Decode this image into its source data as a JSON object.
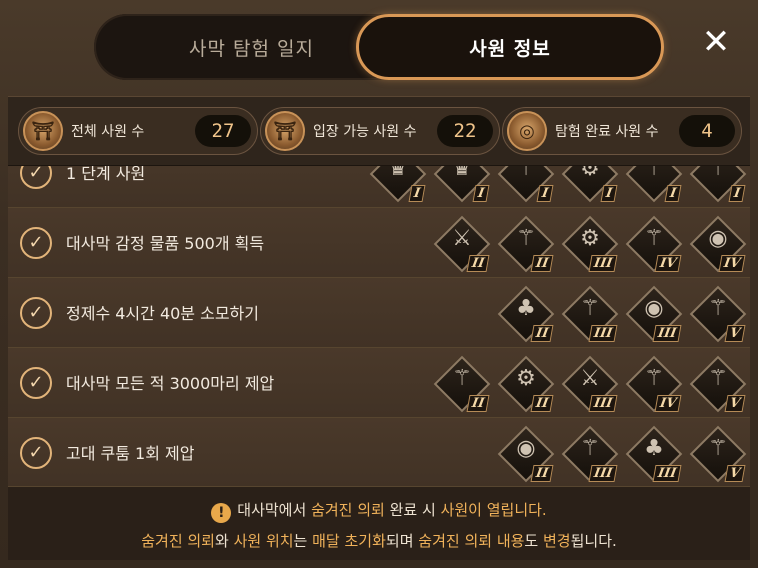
{
  "tabs": {
    "inactive_label": "사막 탐험 일지",
    "active_label": "사원 정보"
  },
  "close_icon": "close-icon",
  "stats": [
    {
      "label": "전체 사원 수",
      "value": "27",
      "icon": "temple-emblem-icon"
    },
    {
      "label": "입장 가능 사원 수",
      "value": "22",
      "icon": "temple-emblem-icon"
    },
    {
      "label": "탐험 완료 사원 수",
      "value": "4",
      "icon": "compass-emblem-icon"
    }
  ],
  "rows": [
    {
      "text": "1 단계 사원",
      "ranks": [
        "I",
        "I",
        "I",
        "I",
        "I",
        "I"
      ],
      "partial": true
    },
    {
      "text": "대사막 감정 물품 500개 획득",
      "ranks": [
        "II",
        "II",
        "III",
        "IV",
        "IV"
      ]
    },
    {
      "text": "정제수 4시간 40분 소모하기",
      "ranks": [
        "II",
        "III",
        "III",
        "V"
      ]
    },
    {
      "text": "대사막 모든 적 3000마리 제압",
      "ranks": [
        "II",
        "II",
        "III",
        "IV",
        "V"
      ]
    },
    {
      "text": "고대 쿠툼 1회 제압",
      "ranks": [
        "II",
        "III",
        "III",
        "V"
      ]
    }
  ],
  "footer": {
    "line1": {
      "a": "대사막에서 ",
      "b": "숨겨진 의뢰",
      "c": " 완료 시 ",
      "d": "사원이 열립니다."
    },
    "line2": {
      "a": "숨겨진 의뢰",
      "b": "와 ",
      "c": "사원 위치",
      "d": "는 ",
      "e": "매달 초기화",
      "f": "되며 ",
      "g": "숨겨진 의뢰 내용",
      "h": "도 ",
      "i": "변경",
      "j": "됩니다."
    }
  },
  "colors": {
    "accent": "#d99856",
    "highlight": "#f0b25a"
  }
}
